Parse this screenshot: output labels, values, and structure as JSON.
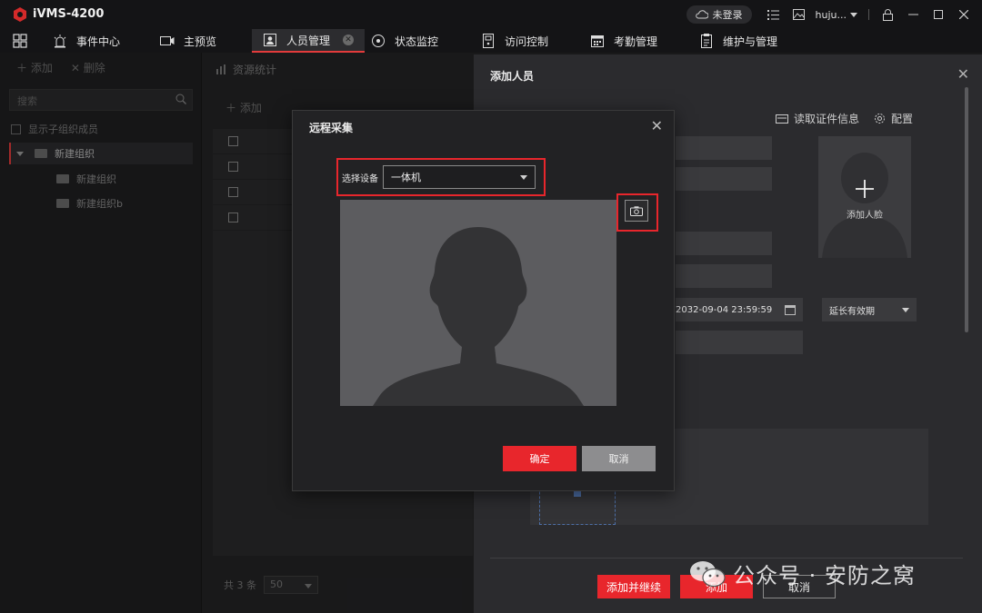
{
  "app": {
    "title": "iVMS-4200",
    "login_status": "未登录",
    "user": "huju..."
  },
  "tabs": [
    {
      "label": "事件中心",
      "icon": "alarm-light-icon"
    },
    {
      "label": "主预览",
      "icon": "video-camera-icon"
    },
    {
      "label": "人员管理",
      "icon": "person-card-icon",
      "active": true
    },
    {
      "label": "状态监控",
      "icon": "monitor-dial-icon"
    },
    {
      "label": "访问控制",
      "icon": "access-door-icon"
    },
    {
      "label": "考勤管理",
      "icon": "calendar-icon"
    },
    {
      "label": "维护与管理",
      "icon": "maintenance-icon"
    }
  ],
  "left_panel": {
    "add_label": "添加",
    "delete_label": "删除",
    "search_placeholder": "搜索",
    "show_sub_members": "显示子组织成员",
    "tree": [
      {
        "label": "新建组织",
        "level": 0
      },
      {
        "label": "新建组织",
        "level": 1
      },
      {
        "label": "新建组织b",
        "level": 1
      }
    ]
  },
  "middle": {
    "header": "资源统计",
    "add_label": "添加",
    "footer_count": "共 3 条",
    "page_size": "50"
  },
  "drawer": {
    "title": "添加人员",
    "read_id_label": "读取证件信息",
    "config_label": "配置",
    "add_face_label": "添加人脸",
    "end_time": "2032-09-04 23:59:59",
    "validity_option": "延长有效期",
    "btn_add_continue": "添加并继续",
    "btn_add": "添加",
    "btn_cancel": "取消"
  },
  "modal": {
    "title": "远程采集",
    "device_label": "选择设备",
    "device_value": "一体机",
    "btn_ok": "确定",
    "btn_cancel": "取消"
  },
  "watermark": {
    "text": "公众号 · 安防之窝"
  },
  "colors": {
    "accent_red": "#e8262c",
    "dark_bg": "#232325"
  }
}
